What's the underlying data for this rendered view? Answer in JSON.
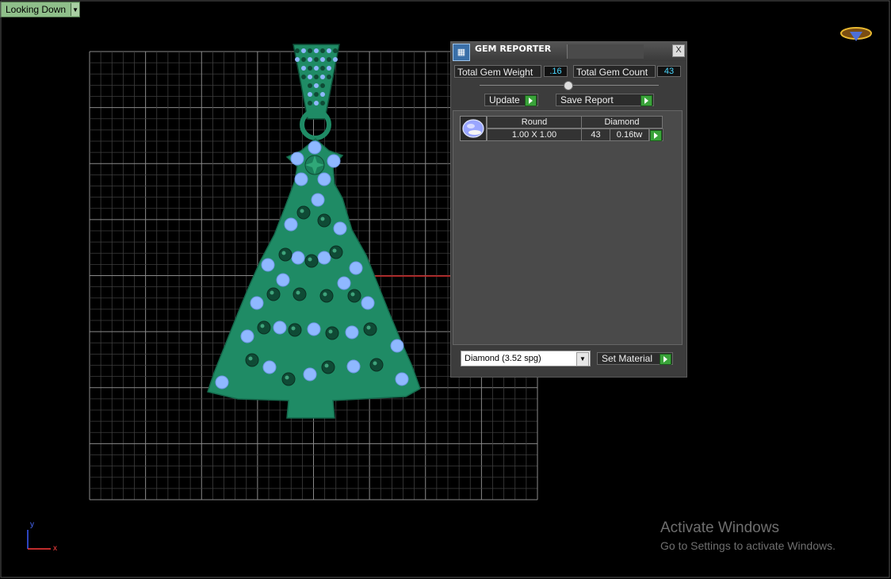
{
  "viewport": {
    "view_label": "Looking Down",
    "axis_y": "y",
    "axis_x": "x"
  },
  "gem_reporter": {
    "title": "GEM REPORTER",
    "close_label": "X",
    "total_gem_weight_label": "Total Gem Weight",
    "total_gem_weight_value": ".16",
    "total_gem_count_label": "Total Gem Count",
    "total_gem_count_value": "43",
    "update_label": "Update",
    "save_report_label": "Save Report",
    "table": {
      "shape_header": "Round",
      "material_header": "Diamond",
      "size": "1.00 X 1.00",
      "count": "43",
      "weight": "0.16tw"
    },
    "material_select": "Diamond    (3.52 spg)",
    "set_material_label": "Set Material"
  },
  "watermark": {
    "line1": "Activate Windows",
    "line2": "Go to Settings to activate Windows."
  },
  "colors": {
    "model_green": "#1f8b65",
    "light_gem": "#8fb8ff",
    "dark_gem": "#0f4a35",
    "grid": "#ffffff",
    "accent_gold": "#d9a62a"
  }
}
